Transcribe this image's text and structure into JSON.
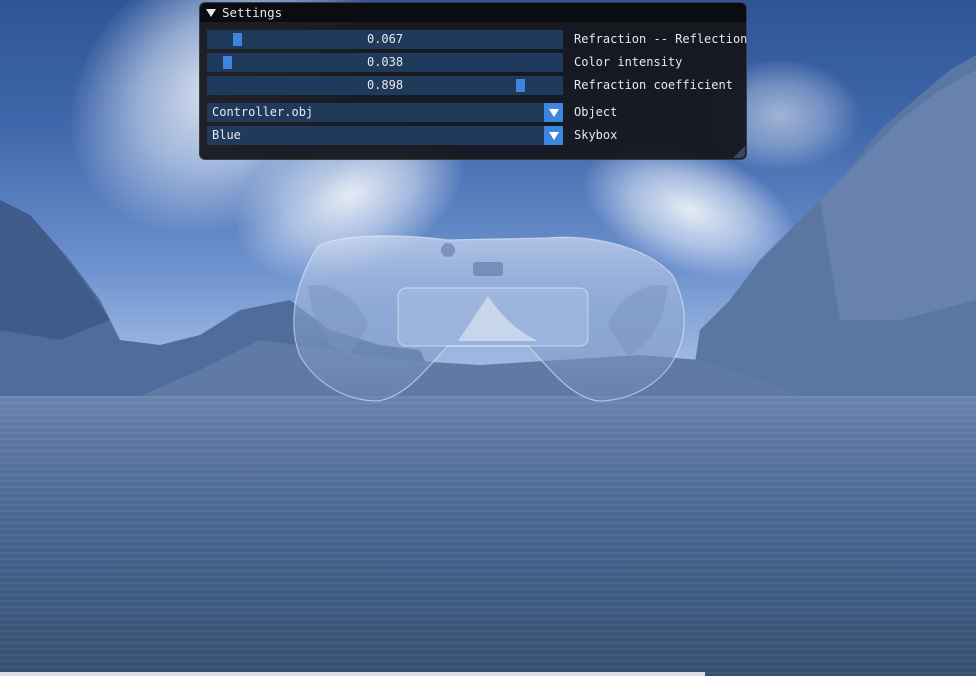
{
  "window": {
    "title": "Settings",
    "collapse_icon": "triangle-down-icon"
  },
  "sliders": [
    {
      "value_text": "0.067",
      "value": 0.067,
      "label": "Refraction -- Reflection"
    },
    {
      "value_text": "0.038",
      "value": 0.038,
      "label": "Color intensity"
    },
    {
      "value_text": "0.898",
      "value": 0.898,
      "label": "Refraction coefficient"
    }
  ],
  "combos": [
    {
      "value": "Controller.obj",
      "label": "Object",
      "icon": "triangle-down-icon"
    },
    {
      "value": "Blue",
      "label": "Skybox",
      "icon": "triangle-down-icon"
    }
  ],
  "colors": {
    "frame_bg": "#203a5c",
    "accent": "#3d86e0",
    "window_bg": "#14151b",
    "text": "#e8e8ea"
  }
}
